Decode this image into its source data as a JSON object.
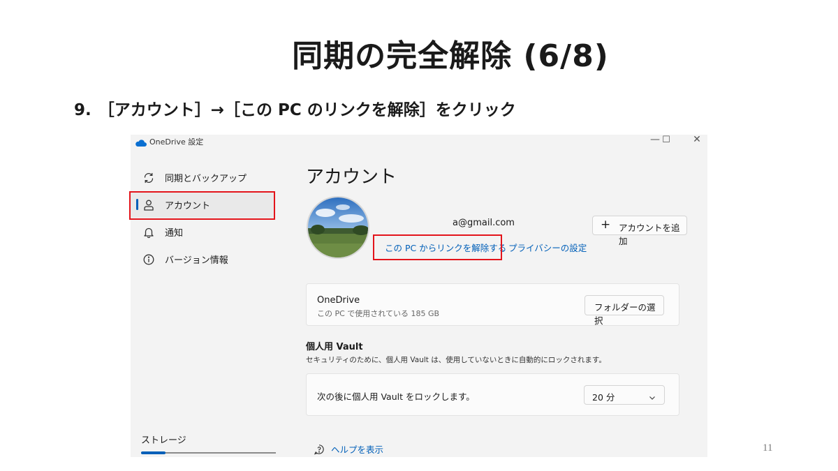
{
  "slide": {
    "title": "同期の完全解除 (6/8)",
    "step_number": "9.",
    "step_text": "［アカウント］→［この PC のリンクを解除］をクリック",
    "page_number": "11"
  },
  "window": {
    "title": "OneDrive 設定",
    "controls": {
      "minimize": "—",
      "maximize": "☐",
      "close": "✕"
    }
  },
  "sidebar": {
    "items": [
      {
        "label": "同期とバックアップ",
        "icon": "sync-icon",
        "active": false
      },
      {
        "label": "アカウント",
        "icon": "person-icon",
        "active": true
      },
      {
        "label": "通知",
        "icon": "bell-icon",
        "active": false
      },
      {
        "label": "バージョン情報",
        "icon": "info-icon",
        "active": false
      }
    ],
    "storage": {
      "label": "ストレージ",
      "used_fraction": 0.18
    }
  },
  "account": {
    "heading": "アカウント",
    "email": "a@gmail.com",
    "unlink_label": "この PC からリンクを解除する",
    "privacy_label": "プライバシーの設定",
    "add_account_label": "アカウントを追加"
  },
  "onedrive_card": {
    "name": "OneDrive",
    "usage": "この PC で使用されている 185 GB",
    "folder_button": "フォルダーの選択"
  },
  "vault": {
    "title": "個人用 Vault",
    "description": "セキュリティのために、個人用 Vault は、使用していないときに自動的にロックされます。",
    "lock_text": "次の後に個人用 Vault をロックします。",
    "selected": "20 分"
  },
  "help_label": "ヘルプを表示",
  "colors": {
    "accent": "#005fb8",
    "highlight": "#e3141b"
  }
}
